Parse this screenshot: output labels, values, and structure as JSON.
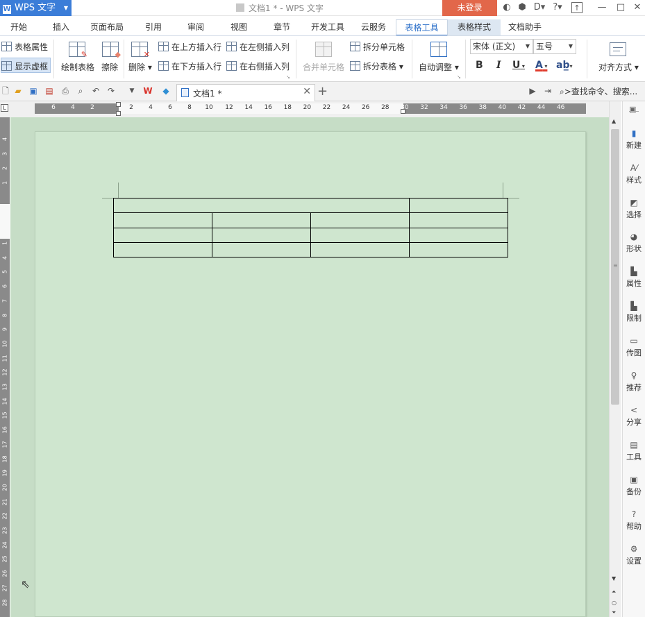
{
  "app": {
    "name": "WPS 文字",
    "window_title": "文档1 * - WPS 文字",
    "login_label": "未登录"
  },
  "menu_tabs": [
    "开始",
    "插入",
    "页面布局",
    "引用",
    "审阅",
    "视图",
    "章节",
    "开发工具",
    "云服务",
    "表格工具",
    "表格样式",
    "文档助手"
  ],
  "active_tab": "表格工具",
  "ribbon": {
    "table_props": "表格属性",
    "show_gridlines": "显示虚框",
    "draw_table": "绘制表格",
    "erase": "擦除",
    "delete": "删除",
    "insert_row_above": "在上方插入行",
    "insert_row_below": "在下方插入行",
    "insert_col_left": "在左侧插入列",
    "insert_col_right": "在右侧插入列",
    "merge_cells": "合并单元格",
    "split_cells": "拆分单元格",
    "split_table": "拆分表格",
    "auto_fit": "自动调整",
    "font_name": "宋体 (正文)",
    "font_size": "五号",
    "bold": "B",
    "italic": "I",
    "underline": "U",
    "font_color": "A",
    "align": "对齐方式"
  },
  "doc_tab": {
    "label": "文档1 *"
  },
  "search_placeholder": ">查找命令、搜索...",
  "hruler_left": [
    "6",
    "4",
    "2",
    "2",
    "4",
    "6",
    "8",
    "10"
  ],
  "hruler_right": [
    "12",
    "14",
    "16",
    "18",
    "20",
    "22",
    "24",
    "26",
    "28",
    "30",
    "32",
    "34",
    "36",
    "38",
    "40",
    "42",
    "44",
    "46"
  ],
  "vruler_top": [
    "4",
    "3",
    "2",
    "1"
  ],
  "vruler": [
    "1",
    "4",
    "5",
    "6",
    "7",
    "8",
    "9",
    "10",
    "11",
    "12",
    "13",
    "14",
    "15",
    "16",
    "17",
    "18",
    "19",
    "20",
    "21",
    "22",
    "23",
    "24",
    "25",
    "26",
    "27",
    "28"
  ],
  "table": {
    "rows": 4,
    "cols": 4
  },
  "right_panel": [
    "新建",
    "样式",
    "选择",
    "形状",
    "属性",
    "限制",
    "传图",
    "推荐",
    "分享",
    "工具",
    "备份",
    "帮助",
    "设置"
  ]
}
